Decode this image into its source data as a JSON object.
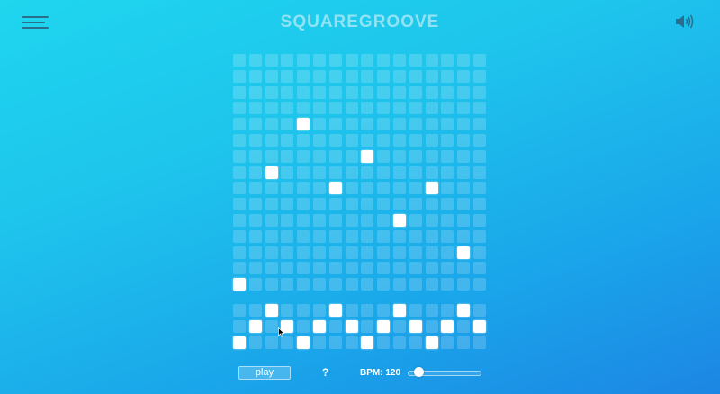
{
  "app": {
    "title": "SQUAREGROOVE",
    "menu_icon": "hamburger-menu-icon",
    "volume_icon": "speaker-volume-icon"
  },
  "colors": {
    "background_start": "#1fd6ee",
    "background_end": "#1c86e4",
    "cell_off": "rgba(255,255,255,0.18)",
    "cell_on": "#ffffff",
    "title": "#8fe3f4"
  },
  "melody_grid": {
    "columns": 16,
    "rows": 15,
    "active_cells": [
      {
        "row": 4,
        "col": 4
      },
      {
        "row": 6,
        "col": 8
      },
      {
        "row": 7,
        "col": 2
      },
      {
        "row": 8,
        "col": 6
      },
      {
        "row": 8,
        "col": 12
      },
      {
        "row": 10,
        "col": 10
      },
      {
        "row": 12,
        "col": 14
      },
      {
        "row": 14,
        "col": 0
      }
    ]
  },
  "drum_grid": {
    "columns": 16,
    "rows": 3,
    "active_cells": [
      {
        "row": 0,
        "col": 2
      },
      {
        "row": 0,
        "col": 6
      },
      {
        "row": 0,
        "col": 10
      },
      {
        "row": 0,
        "col": 14
      },
      {
        "row": 1,
        "col": 1
      },
      {
        "row": 1,
        "col": 3
      },
      {
        "row": 1,
        "col": 5
      },
      {
        "row": 1,
        "col": 7
      },
      {
        "row": 1,
        "col": 9
      },
      {
        "row": 1,
        "col": 11
      },
      {
        "row": 1,
        "col": 13
      },
      {
        "row": 1,
        "col": 15
      },
      {
        "row": 2,
        "col": 0
      },
      {
        "row": 2,
        "col": 4
      },
      {
        "row": 2,
        "col": 8
      },
      {
        "row": 2,
        "col": 12
      }
    ]
  },
  "controls": {
    "play_label": "play",
    "help_label": "?",
    "bpm_label": "BPM: 120",
    "bpm_value": 120,
    "bpm_slider_fraction": 0.1
  }
}
